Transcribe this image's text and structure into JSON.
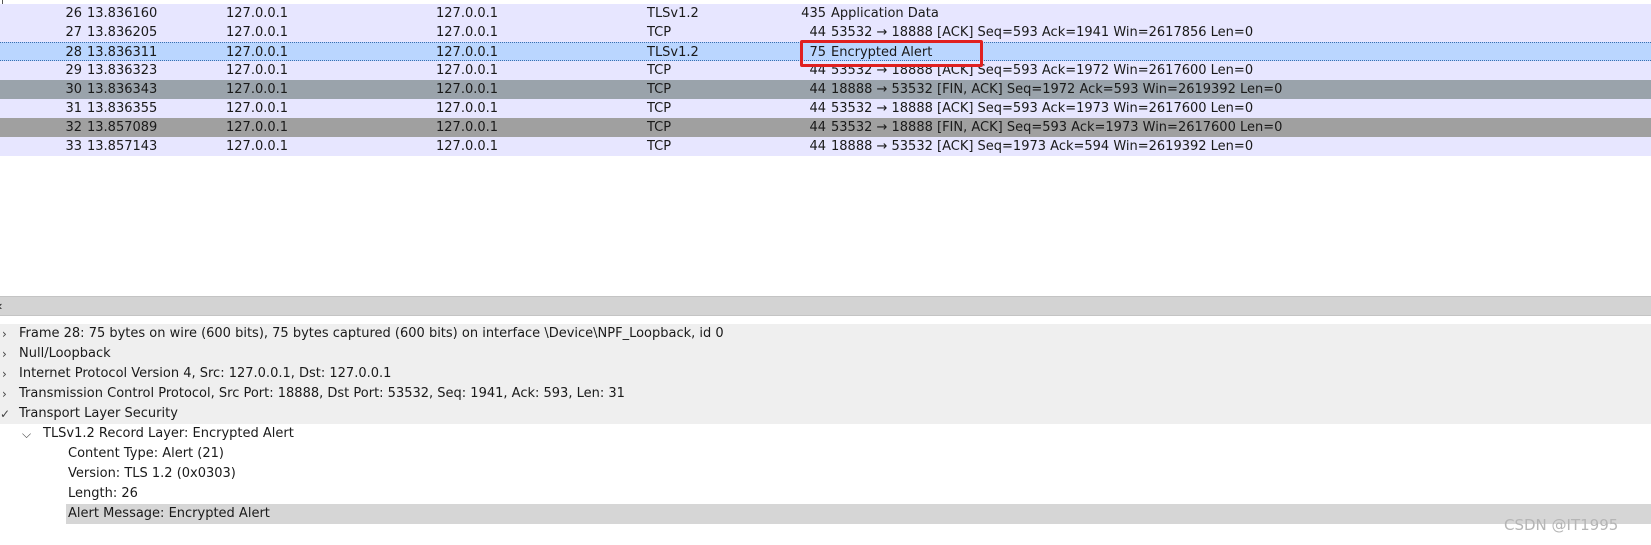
{
  "packets": [
    {
      "no": "26",
      "time": "13.836160",
      "src": "127.0.0.1",
      "dst": "127.0.0.1",
      "proto": "TLSv1.2",
      "len": "435",
      "info": "Application Data"
    },
    {
      "no": "27",
      "time": "13.836205",
      "src": "127.0.0.1",
      "dst": "127.0.0.1",
      "proto": "TCP",
      "len": "44",
      "info": "53532 → 18888 [ACK] Seq=593 Ack=1941 Win=2617856 Len=0"
    },
    {
      "no": "28",
      "time": "13.836311",
      "src": "127.0.0.1",
      "dst": "127.0.0.1",
      "proto": "TLSv1.2",
      "len": "75",
      "info": "Encrypted Alert"
    },
    {
      "no": "29",
      "time": "13.836323",
      "src": "127.0.0.1",
      "dst": "127.0.0.1",
      "proto": "TCP",
      "len": "44",
      "info": "53532 → 18888 [ACK] Seq=593 Ack=1972 Win=2617600 Len=0"
    },
    {
      "no": "30",
      "time": "13.836343",
      "src": "127.0.0.1",
      "dst": "127.0.0.1",
      "proto": "TCP",
      "len": "44",
      "info": "18888 → 53532 [FIN, ACK] Seq=1972 Ack=593 Win=2619392 Len=0"
    },
    {
      "no": "31",
      "time": "13.836355",
      "src": "127.0.0.1",
      "dst": "127.0.0.1",
      "proto": "TCP",
      "len": "44",
      "info": "53532 → 18888 [ACK] Seq=593 Ack=1973 Win=2617600 Len=0"
    },
    {
      "no": "32",
      "time": "13.857089",
      "src": "127.0.0.1",
      "dst": "127.0.0.1",
      "proto": "TCP",
      "len": "44",
      "info": "53532 → 18888 [FIN, ACK] Seq=593 Ack=1973 Win=2617600 Len=0"
    },
    {
      "no": "33",
      "time": "13.857143",
      "src": "127.0.0.1",
      "dst": "127.0.0.1",
      "proto": "TCP",
      "len": "44",
      "info": "18888 → 53532 [ACK] Seq=1973 Ack=594 Win=2619392 Len=0"
    }
  ],
  "details": {
    "frame": "Frame 28: 75 bytes on wire (600 bits), 75 bytes captured (600 bits) on interface \\Device\\NPF_Loopback, id 0",
    "null_loopback": "Null/Loopback",
    "ipv4": "Internet Protocol Version 4, Src: 127.0.0.1, Dst: 127.0.0.1",
    "tcp": "Transmission Control Protocol, Src Port: 18888, Dst Port: 53532, Seq: 1941, Ack: 593, Len: 31",
    "tls": "Transport Layer Security",
    "record": "TLSv1.2 Record Layer: Encrypted Alert",
    "content_type": "Content Type: Alert (21)",
    "version": "Version: TLS 1.2 (0x0303)",
    "length": "Length: 26",
    "alert_message": "Alert Message: Encrypted Alert"
  },
  "icons": {
    "collapsed": "chevron-right-icon",
    "expanded": "chevron-down-icon"
  },
  "colors": {
    "selected": "#bad6ff",
    "row": "#e7e6ff",
    "highlight": "#e02020",
    "dark_a": "#9aa3ab",
    "dark_b": "#a0a0a0"
  },
  "watermark": "CSDN @IT1995"
}
